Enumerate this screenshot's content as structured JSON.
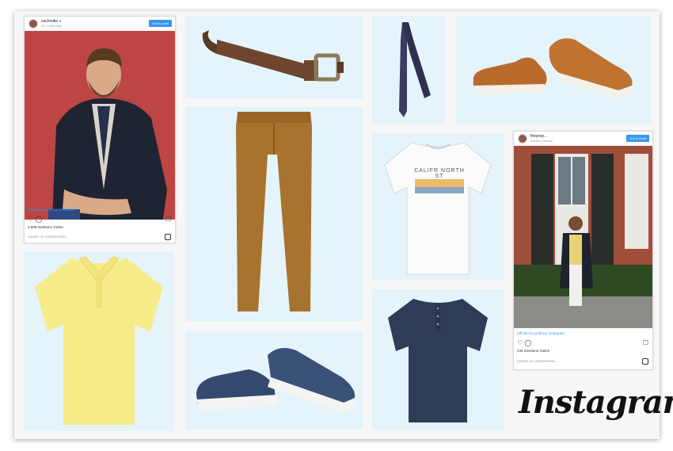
{
  "post1": {
    "username": "zachmiko",
    "subtitle": "414 k abonnés",
    "view_profile": "Voir le profil",
    "profile_link": "Afficher le profil sur Instagram",
    "likes": "3.339 mentions J'aime",
    "comment_placeholder": "Ajouter un commentaire..."
  },
  "post2": {
    "username": "theprop...",
    "subtitle": "Ganvia, Ontario",
    "view_profile": "Voir le profil",
    "profile_link": "Afficher le profil sur Instagram",
    "likes": "244 mentions J'aime",
    "comment_placeholder": "Ajouter un commentaire..."
  },
  "tshirt_print": "CALIFR NORTH ST",
  "brand": "Instagram",
  "icons": [
    "heart-icon",
    "comment-icon",
    "bookmark-icon",
    "instagram-icon",
    "verified-icon"
  ],
  "colors": {
    "tile_bg": "#e4f4fa",
    "accent": "#3897f0"
  }
}
